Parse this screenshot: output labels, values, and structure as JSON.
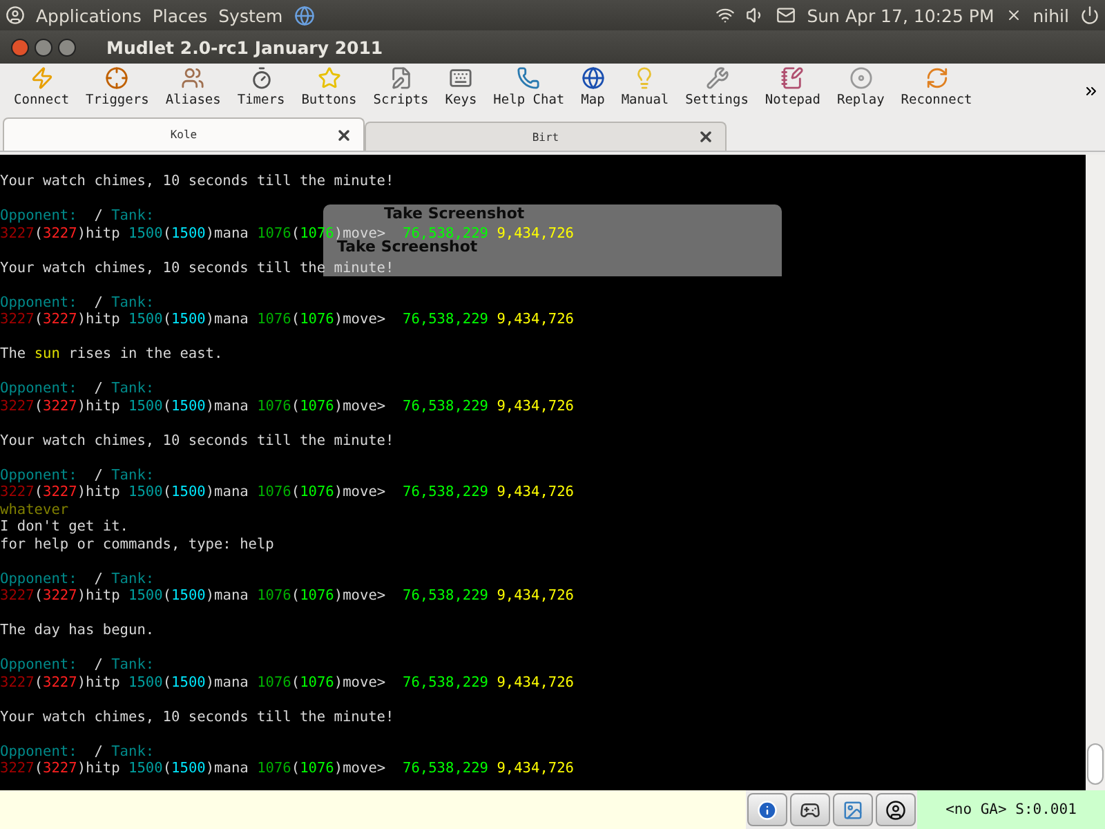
{
  "top_panel": {
    "menus": [
      "Applications",
      "Places",
      "System"
    ],
    "clock": "Sun Apr 17, 10:25 PM",
    "user": "nihil"
  },
  "window": {
    "title": "Mudlet 2.0-rc1 January 2011"
  },
  "toolbar": [
    {
      "label": "Connect",
      "kind": "connect"
    },
    {
      "label": "Triggers",
      "kind": "triggers"
    },
    {
      "label": "Aliases",
      "kind": "aliases"
    },
    {
      "label": "Timers",
      "kind": "timers"
    },
    {
      "label": "Buttons",
      "kind": "buttons"
    },
    {
      "label": "Scripts",
      "kind": "scripts"
    },
    {
      "label": "Keys",
      "kind": "keys"
    },
    {
      "label": "Help Chat",
      "kind": "chat"
    },
    {
      "label": "Map",
      "kind": "map"
    },
    {
      "label": "Manual",
      "kind": "manual"
    },
    {
      "label": "Settings",
      "kind": "settings"
    },
    {
      "label": "Notepad",
      "kind": "notepad"
    },
    {
      "label": "Replay",
      "kind": "replay"
    },
    {
      "label": "Reconnect",
      "kind": "reconnect"
    }
  ],
  "tabs": [
    {
      "label": "Kole",
      "selected": true
    },
    {
      "label": "Birt",
      "selected": false
    }
  ],
  "console": {
    "lines": [
      {
        "kind": "text",
        "segments": [
          {
            "text": "Your watch chimes, 10 seconds till the minute!",
            "color": "#d8d8d8"
          }
        ]
      },
      {
        "kind": "blank"
      },
      {
        "kind": "text",
        "segments": [
          {
            "text": "Opponent:",
            "color": "#008b8b"
          },
          {
            "text": "  / ",
            "color": "#d8d8d8"
          },
          {
            "text": "Tank:",
            "color": "#008b8b"
          }
        ]
      },
      {
        "kind": "text",
        "segments": [
          {
            "text": "3227",
            "color": "#a00000"
          },
          {
            "text": "(",
            "color": "#d8d8d8"
          },
          {
            "text": "3227",
            "color": "#ff2020"
          },
          {
            "text": ")hitp ",
            "color": "#d8d8d8"
          },
          {
            "text": "1500",
            "color": "#00a0a0"
          },
          {
            "text": "(",
            "color": "#d8d8d8"
          },
          {
            "text": "1500",
            "color": "#00e8ff"
          },
          {
            "text": ")mana ",
            "color": "#d8d8d8"
          },
          {
            "text": "1076",
            "color": "#00b000"
          },
          {
            "text": "(",
            "color": "#d8d8d8"
          },
          {
            "text": "1076",
            "color": "#00ff00"
          },
          {
            "text": ")move>  ",
            "color": "#d8d8d8"
          },
          {
            "text": "76,538,229 ",
            "color": "#00ff00"
          },
          {
            "text": "9,434,726",
            "color": "#ffff00"
          }
        ]
      },
      {
        "kind": "blank"
      },
      {
        "kind": "text",
        "segments": [
          {
            "text": "Your watch chimes, 10 seconds till the minute!",
            "color": "#d8d8d8"
          }
        ]
      },
      {
        "kind": "blank"
      },
      {
        "kind": "text",
        "segments": [
          {
            "text": "Opponent:",
            "color": "#008b8b"
          },
          {
            "text": "  / ",
            "color": "#d8d8d8"
          },
          {
            "text": "Tank:",
            "color": "#008b8b"
          }
        ]
      },
      {
        "kind": "text",
        "segments": [
          {
            "text": "3227",
            "color": "#a00000"
          },
          {
            "text": "(",
            "color": "#d8d8d8"
          },
          {
            "text": "3227",
            "color": "#ff2020"
          },
          {
            "text": ")hitp ",
            "color": "#d8d8d8"
          },
          {
            "text": "1500",
            "color": "#00a0a0"
          },
          {
            "text": "(",
            "color": "#d8d8d8"
          },
          {
            "text": "1500",
            "color": "#00e8ff"
          },
          {
            "text": ")mana ",
            "color": "#d8d8d8"
          },
          {
            "text": "1076",
            "color": "#00b000"
          },
          {
            "text": "(",
            "color": "#d8d8d8"
          },
          {
            "text": "1076",
            "color": "#00ff00"
          },
          {
            "text": ")move>  ",
            "color": "#d8d8d8"
          },
          {
            "text": "76,538,229 ",
            "color": "#00ff00"
          },
          {
            "text": "9,434,726",
            "color": "#ffff00"
          }
        ]
      },
      {
        "kind": "blank"
      },
      {
        "kind": "text",
        "segments": [
          {
            "text": "The ",
            "color": "#d8d8d8"
          },
          {
            "text": "sun",
            "color": "#e0e000"
          },
          {
            "text": " rises in the east.",
            "color": "#d8d8d8"
          }
        ]
      },
      {
        "kind": "blank"
      },
      {
        "kind": "text",
        "segments": [
          {
            "text": "Opponent:",
            "color": "#008b8b"
          },
          {
            "text": "  / ",
            "color": "#d8d8d8"
          },
          {
            "text": "Tank:",
            "color": "#008b8b"
          }
        ]
      },
      {
        "kind": "text",
        "segments": [
          {
            "text": "3227",
            "color": "#a00000"
          },
          {
            "text": "(",
            "color": "#d8d8d8"
          },
          {
            "text": "3227",
            "color": "#ff2020"
          },
          {
            "text": ")hitp ",
            "color": "#d8d8d8"
          },
          {
            "text": "1500",
            "color": "#00a0a0"
          },
          {
            "text": "(",
            "color": "#d8d8d8"
          },
          {
            "text": "1500",
            "color": "#00e8ff"
          },
          {
            "text": ")mana ",
            "color": "#d8d8d8"
          },
          {
            "text": "1076",
            "color": "#00b000"
          },
          {
            "text": "(",
            "color": "#d8d8d8"
          },
          {
            "text": "1076",
            "color": "#00ff00"
          },
          {
            "text": ")move>  ",
            "color": "#d8d8d8"
          },
          {
            "text": "76,538,229 ",
            "color": "#00ff00"
          },
          {
            "text": "9,434,726",
            "color": "#ffff00"
          }
        ]
      },
      {
        "kind": "blank"
      },
      {
        "kind": "text",
        "segments": [
          {
            "text": "Your watch chimes, 10 seconds till the minute!",
            "color": "#d8d8d8"
          }
        ]
      },
      {
        "kind": "blank"
      },
      {
        "kind": "text",
        "segments": [
          {
            "text": "Opponent:",
            "color": "#008b8b"
          },
          {
            "text": "  / ",
            "color": "#d8d8d8"
          },
          {
            "text": "Tank:",
            "color": "#008b8b"
          }
        ]
      },
      {
        "kind": "text",
        "segments": [
          {
            "text": "3227",
            "color": "#a00000"
          },
          {
            "text": "(",
            "color": "#d8d8d8"
          },
          {
            "text": "3227",
            "color": "#ff2020"
          },
          {
            "text": ")hitp ",
            "color": "#d8d8d8"
          },
          {
            "text": "1500",
            "color": "#00a0a0"
          },
          {
            "text": "(",
            "color": "#d8d8d8"
          },
          {
            "text": "1500",
            "color": "#00e8ff"
          },
          {
            "text": ")mana ",
            "color": "#d8d8d8"
          },
          {
            "text": "1076",
            "color": "#00b000"
          },
          {
            "text": "(",
            "color": "#d8d8d8"
          },
          {
            "text": "1076",
            "color": "#00ff00"
          },
          {
            "text": ")move>  ",
            "color": "#d8d8d8"
          },
          {
            "text": "76,538,229 ",
            "color": "#00ff00"
          },
          {
            "text": "9,434,726",
            "color": "#ffff00"
          }
        ]
      },
      {
        "kind": "text",
        "segments": [
          {
            "text": "whatever",
            "color": "#808000"
          }
        ]
      },
      {
        "kind": "text",
        "segments": [
          {
            "text": "I don't get it.",
            "color": "#d8d8d8"
          }
        ]
      },
      {
        "kind": "text",
        "segments": [
          {
            "text": "for help or commands, type: help",
            "color": "#d8d8d8"
          }
        ]
      },
      {
        "kind": "blank"
      },
      {
        "kind": "text",
        "segments": [
          {
            "text": "Opponent:",
            "color": "#008b8b"
          },
          {
            "text": "  / ",
            "color": "#d8d8d8"
          },
          {
            "text": "Tank:",
            "color": "#008b8b"
          }
        ]
      },
      {
        "kind": "text",
        "segments": [
          {
            "text": "3227",
            "color": "#a00000"
          },
          {
            "text": "(",
            "color": "#d8d8d8"
          },
          {
            "text": "3227",
            "color": "#ff2020"
          },
          {
            "text": ")hitp ",
            "color": "#d8d8d8"
          },
          {
            "text": "1500",
            "color": "#00a0a0"
          },
          {
            "text": "(",
            "color": "#d8d8d8"
          },
          {
            "text": "1500",
            "color": "#00e8ff"
          },
          {
            "text": ")mana ",
            "color": "#d8d8d8"
          },
          {
            "text": "1076",
            "color": "#00b000"
          },
          {
            "text": "(",
            "color": "#d8d8d8"
          },
          {
            "text": "1076",
            "color": "#00ff00"
          },
          {
            "text": ")move>  ",
            "color": "#d8d8d8"
          },
          {
            "text": "76,538,229 ",
            "color": "#00ff00"
          },
          {
            "text": "9,434,726",
            "color": "#ffff00"
          }
        ]
      },
      {
        "kind": "blank"
      },
      {
        "kind": "text",
        "segments": [
          {
            "text": "The day has begun.",
            "color": "#d8d8d8"
          }
        ]
      },
      {
        "kind": "blank"
      },
      {
        "kind": "text",
        "segments": [
          {
            "text": "Opponent:",
            "color": "#008b8b"
          },
          {
            "text": "  / ",
            "color": "#d8d8d8"
          },
          {
            "text": "Tank:",
            "color": "#008b8b"
          }
        ]
      },
      {
        "kind": "text",
        "segments": [
          {
            "text": "3227",
            "color": "#a00000"
          },
          {
            "text": "(",
            "color": "#d8d8d8"
          },
          {
            "text": "3227",
            "color": "#ff2020"
          },
          {
            "text": ")hitp ",
            "color": "#d8d8d8"
          },
          {
            "text": "1500",
            "color": "#00a0a0"
          },
          {
            "text": "(",
            "color": "#d8d8d8"
          },
          {
            "text": "1500",
            "color": "#00e8ff"
          },
          {
            "text": ")mana ",
            "color": "#d8d8d8"
          },
          {
            "text": "1076",
            "color": "#00b000"
          },
          {
            "text": "(",
            "color": "#d8d8d8"
          },
          {
            "text": "1076",
            "color": "#00ff00"
          },
          {
            "text": ")move>  ",
            "color": "#d8d8d8"
          },
          {
            "text": "76,538,229 ",
            "color": "#00ff00"
          },
          {
            "text": "9,434,726",
            "color": "#ffff00"
          }
        ]
      },
      {
        "kind": "blank"
      },
      {
        "kind": "text",
        "segments": [
          {
            "text": "Your watch chimes, 10 seconds till the minute!",
            "color": "#d8d8d8"
          }
        ]
      },
      {
        "kind": "blank"
      },
      {
        "kind": "text",
        "segments": [
          {
            "text": "Opponent:",
            "color": "#008b8b"
          },
          {
            "text": "  / ",
            "color": "#d8d8d8"
          },
          {
            "text": "Tank:",
            "color": "#008b8b"
          }
        ]
      },
      {
        "kind": "text",
        "segments": [
          {
            "text": "3227",
            "color": "#a00000"
          },
          {
            "text": "(",
            "color": "#d8d8d8"
          },
          {
            "text": "3227",
            "color": "#ff2020"
          },
          {
            "text": ")hitp ",
            "color": "#d8d8d8"
          },
          {
            "text": "1500",
            "color": "#00a0a0"
          },
          {
            "text": "(",
            "color": "#d8d8d8"
          },
          {
            "text": "1500",
            "color": "#00e8ff"
          },
          {
            "text": ")mana ",
            "color": "#d8d8d8"
          },
          {
            "text": "1076",
            "color": "#00b000"
          },
          {
            "text": "(",
            "color": "#d8d8d8"
          },
          {
            "text": "1076",
            "color": "#00ff00"
          },
          {
            "text": ")move>  ",
            "color": "#d8d8d8"
          },
          {
            "text": "76,538,229 ",
            "color": "#00ff00"
          },
          {
            "text": "9,434,726",
            "color": "#ffff00"
          }
        ]
      }
    ]
  },
  "ghost_dialog": {
    "title": "Take Screenshot",
    "heading": "Take Screenshot"
  },
  "status_bar": {
    "status": "<no GA> S:0.001"
  }
}
